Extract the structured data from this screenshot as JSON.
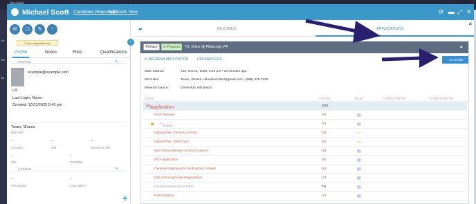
{
  "background": {
    "logo": "8mobile",
    "side_letters": [
      "Ac",
      "Re",
      "Mi"
    ]
  },
  "header": {
    "name": "Michael Scott",
    "candidate_status": "Candidate [Rejected]",
    "applicant_status": "Applicant: New",
    "accent": "#3b97c8"
  },
  "left": {
    "open_apps": "1 Open Application(s)",
    "tabs": [
      "Profile",
      "Notes",
      "Files",
      "Qualifications"
    ],
    "section_profile": "PROFILE",
    "email": "example@example.com",
    "dash": "-",
    "country": "US",
    "last_login": "Last Login: Never",
    "created": "Created: 10/21/2025 3:49 pm",
    "recruiter_value": "Twain, Shania",
    "recruiter_label": "Recruiter",
    "location_label": "Location",
    "job_label": "Job",
    "business_unit_label": "Business Unit",
    "site_label": "Site",
    "birthdate_label": "Birthdate",
    "section_license": "LICENSE",
    "first_name_label": "First Name",
    "last_name_label": "Last Name"
  },
  "right": {
    "tab_records": "RECORDS",
    "tab_applications": "APPLICATIONS",
    "primary": "Primary",
    "in_progress": "In Progress",
    "job_title": "TD, Driver @ Pittsburgh, PA",
    "refresh": "REFRESH APPLICATION",
    "upload": "UPLOAD FILES",
    "actions": "ACTIONS",
    "date_started_label": "Date Started:",
    "date_started_value": "Tue, Oct 21, 2025, 3:49 pm • 10 minutes ago",
    "recruiter_label": "Recruiter:",
    "recruiter_value": "Twain, Shania • blondevicster@gmail.com • (865) 415-7425",
    "referral_label": "Referral Source:",
    "referral_value": "DriverHub Job Board",
    "table_headers": [
      "TASKS",
      "STATUS",
      "RESP.",
      "COMPLETED BY",
      "COMPLETED ON"
    ],
    "rows": [
      {
        "task": "Application",
        "status": "0/10",
        "kind": "group"
      },
      {
        "task": "MVR Release",
        "status": "0/1",
        "kind": "task"
      },
      {
        "task": "Trigger",
        "status": "0/1",
        "kind": "sub"
      },
      {
        "task": "Upload File - Drivers License",
        "status": "0/1",
        "kind": "task"
      },
      {
        "task": "Upload File - Med Card",
        "status": "0/1",
        "kind": "task"
      },
      {
        "task": "D&A Clearinghouse Limited Consent",
        "status": "0/1",
        "kind": "task"
      },
      {
        "task": "DOT Application",
        "status": "0/8",
        "kind": "task"
      },
      {
        "task": "General Employment Verification Consent",
        "status": "0/1",
        "kind": "task"
      },
      {
        "task": "D&A Clearinghouse Registration",
        "status": "0/1",
        "kind": "task"
      },
      {
        "task": "Personal Information Form",
        "status": "TN",
        "kind": "faded"
      },
      {
        "task": "PSP Consent",
        "status": "0/1",
        "kind": "task"
      }
    ]
  },
  "arrow_color": "#2a1f6e"
}
